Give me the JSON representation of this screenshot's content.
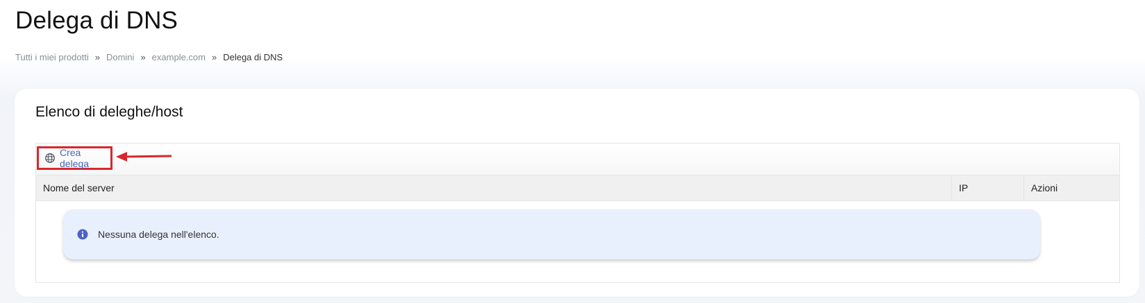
{
  "page": {
    "title": "Delega di DNS"
  },
  "breadcrumb": {
    "items": [
      "Tutti i miei prodotti",
      "Domini",
      "example.com"
    ],
    "current": "Delega di DNS",
    "separator": "»"
  },
  "card": {
    "title": "Elenco di deleghe/host"
  },
  "toolbar": {
    "create_label": "Crea delega",
    "create_icon": "globe-icon"
  },
  "table": {
    "columns": [
      "Nome del server",
      "IP",
      "Azioni"
    ],
    "rows": []
  },
  "empty_state": {
    "icon": "info-icon",
    "message": "Nessuna delega nell'elenco."
  },
  "colors": {
    "link": "#4a65b8",
    "highlight": "#d9262c",
    "alert_bg": "#e9f0fd",
    "info_icon": "#4a63c8"
  }
}
